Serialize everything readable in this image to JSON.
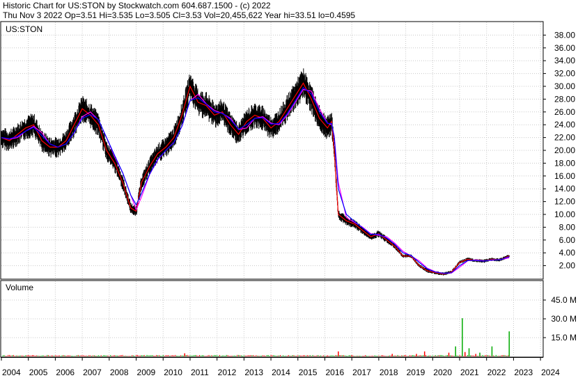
{
  "header": {
    "line1": "Historic Chart for US:STON by Stockwatch.com 604.687.1500 - (c) 2022",
    "line2": "Thu Nov  3 2022   Op=3.51  Hi=3.535   Lo=3.505   Cl=3.53   Vol=20,455,622   Year hi=33.51   lo=0.4595"
  },
  "chart_data": [
    {
      "type": "line",
      "panel": "price",
      "title": "US:STON",
      "ylim": [
        0,
        40
      ],
      "yticks": [
        "2.00",
        "4.00",
        "6.00",
        "8.00",
        "10.00",
        "12.00",
        "14.00",
        "16.00",
        "18.00",
        "20.00",
        "22.00",
        "24.00",
        "26.00",
        "28.00",
        "30.00",
        "32.00",
        "34.00",
        "36.00",
        "38.00"
      ],
      "x": [
        2004.0,
        2004.3,
        2004.6,
        2004.9,
        2005.2,
        2005.5,
        2005.8,
        2006.1,
        2006.4,
        2006.7,
        2007.0,
        2007.3,
        2007.6,
        2007.9,
        2008.2,
        2008.5,
        2008.8,
        2009.0,
        2009.2,
        2009.5,
        2009.8,
        2010.1,
        2010.4,
        2010.7,
        2011.0,
        2011.3,
        2011.6,
        2011.9,
        2012.2,
        2012.5,
        2012.8,
        2013.1,
        2013.4,
        2013.7,
        2014.0,
        2014.3,
        2014.6,
        2014.9,
        2015.2,
        2015.5,
        2015.8,
        2016.1,
        2016.25,
        2016.35,
        2016.5,
        2016.8,
        2017.1,
        2017.4,
        2017.7,
        2018.0,
        2018.3,
        2018.6,
        2018.9,
        2019.2,
        2019.5,
        2019.8,
        2020.1,
        2020.4,
        2020.7,
        2021.0,
        2021.3,
        2021.6,
        2021.9,
        2022.2,
        2022.5,
        2022.84
      ],
      "series": [
        {
          "values": [
            22.0,
            21.5,
            22.5,
            23.5,
            24.0,
            21.5,
            20.5,
            20.5,
            21.5,
            24.0,
            26.5,
            25.5,
            24.0,
            20.0,
            18.0,
            15.0,
            11.0,
            10.5,
            15.0,
            17.5,
            19.5,
            20.5,
            22.0,
            25.5,
            30.0,
            27.5,
            27.0,
            25.5,
            26.0,
            24.0,
            22.5,
            24.5,
            25.5,
            25.0,
            23.5,
            24.5,
            26.5,
            28.5,
            30.5,
            28.0,
            25.0,
            23.5,
            24.5,
            20.0,
            10.0,
            9.0,
            8.5,
            7.5,
            6.5,
            7.0,
            6.0,
            5.0,
            3.5,
            3.5,
            2.0,
            1.2,
            0.9,
            0.7,
            1.0,
            2.5,
            3.0,
            2.8,
            2.7,
            3.0,
            2.9,
            3.53
          ]
        },
        {
          "values": [
            22.0,
            21.8,
            22.2,
            23.0,
            23.6,
            22.3,
            21.0,
            20.5,
            21.0,
            22.8,
            25.0,
            25.6,
            24.8,
            22.0,
            19.2,
            16.5,
            13.0,
            11.5,
            13.3,
            16.3,
            18.6,
            20.0,
            21.2,
            23.8,
            27.8,
            28.2,
            27.2,
            26.0,
            25.8,
            24.8,
            23.3,
            24.0,
            25.0,
            25.1,
            24.1,
            24.2,
            25.7,
            27.7,
            29.8,
            28.8,
            26.0,
            24.2,
            24.2,
            22.0,
            14.0,
            10.0,
            8.9,
            7.9,
            6.9,
            6.9,
            6.3,
            5.3,
            4.0,
            3.6,
            2.5,
            1.5,
            1.0,
            0.8,
            0.9,
            2.0,
            2.8,
            2.8,
            2.7,
            2.9,
            2.9,
            3.4
          ]
        }
      ],
      "colors": {
        "bars": "#000000",
        "ma_short": "#ff0000",
        "ma_long": "#0000ff",
        "ma_mid": "#ff00ff"
      }
    },
    {
      "type": "bar",
      "panel": "volume",
      "title": "Volume",
      "ylim": [
        0,
        60
      ],
      "yticks": [
        "15.0 M",
        "30.0 M",
        "45.0 M"
      ],
      "x": [
        2005.0,
        2007.5,
        2010.8,
        2016.1,
        2016.5,
        2017.0,
        2018.5,
        2019.4,
        2019.7,
        2020.6,
        2020.85,
        2021.1,
        2021.2,
        2021.35,
        2021.6,
        2021.75,
        2022.2,
        2022.84
      ],
      "values": [
        0.3,
        0.4,
        2.5,
        0.5,
        4.0,
        1.0,
        2.0,
        2.0,
        4.0,
        3.0,
        8.0,
        30.5,
        3.5,
        6.5,
        2.0,
        3.0,
        8.0,
        20.0
      ],
      "bar_colors": [
        "#ff0000",
        "#ff0000",
        "#ff0000",
        "#ff0000",
        "#ff0000",
        "#ff0000",
        "#ff0000",
        "#ff0000",
        "#ff0000",
        "#ff0000",
        "#00aa00",
        "#00aa00",
        "#ff0000",
        "#00aa00",
        "#ff0000",
        "#00aa00",
        "#00aa00",
        "#00aa00"
      ]
    }
  ],
  "x_axis": {
    "labels": [
      "2004",
      "2005",
      "2006",
      "2007",
      "2008",
      "2009",
      "2010",
      "2011",
      "2012",
      "2013",
      "2014",
      "2015",
      "2016",
      "2017",
      "2018",
      "2019",
      "2020",
      "2021",
      "2022",
      "2023",
      "2024"
    ]
  }
}
